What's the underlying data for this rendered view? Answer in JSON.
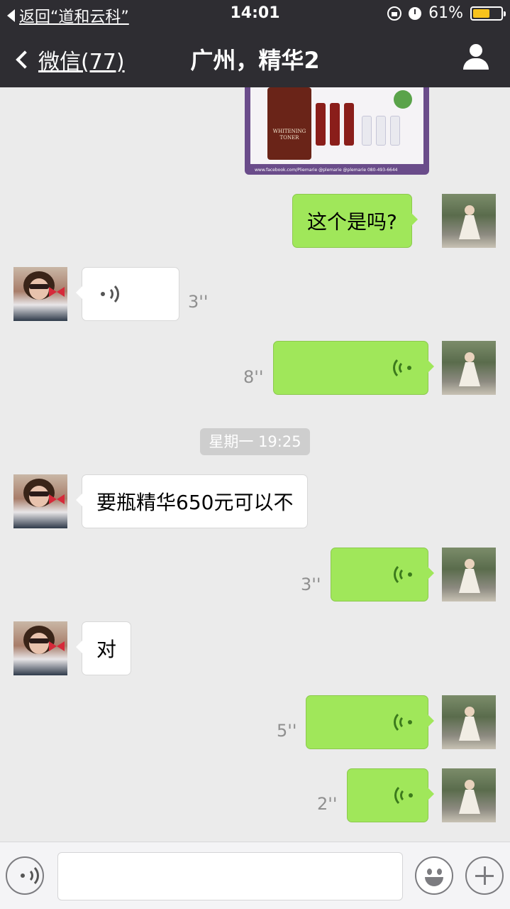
{
  "status_bar": {
    "back_app": "返回“道和云科”",
    "time": "14:01",
    "battery": "61%",
    "battery_level": 0.61
  },
  "nav": {
    "back_label": "微信(77)",
    "title": "广州，精华2",
    "profile_icon": "person-icon"
  },
  "image_message": {
    "product_label": "WHITENING TONER",
    "footer": "www.facebook.com/Pliemarie   @plemarie   @plemarie   080-493-6644"
  },
  "messages": [
    {
      "from": "self",
      "type": "text",
      "text": "这个是吗?"
    },
    {
      "from": "other",
      "type": "voice",
      "duration": "3''"
    },
    {
      "from": "self",
      "type": "voice",
      "duration": "8''"
    },
    {
      "from": "system",
      "type": "timestamp",
      "text": "星期一 19:25"
    },
    {
      "from": "other",
      "type": "text",
      "text": "要瓶精华650元可以不"
    },
    {
      "from": "self",
      "type": "voice",
      "duration": "3''"
    },
    {
      "from": "other",
      "type": "text",
      "text": "对"
    },
    {
      "from": "self",
      "type": "voice",
      "duration": "5''"
    },
    {
      "from": "self",
      "type": "voice",
      "duration": "2''"
    }
  ],
  "input_bar": {
    "voice_toggle_icon": "voice-icon",
    "emoji_icon": "emoji-icon",
    "more_icon": "plus-icon"
  },
  "colors": {
    "nav_bg": "#2e2d32",
    "chat_bg": "#ebebeb",
    "self_bubble": "#a0e75a",
    "other_bubble": "#ffffff",
    "battery": "#f7c21c"
  }
}
